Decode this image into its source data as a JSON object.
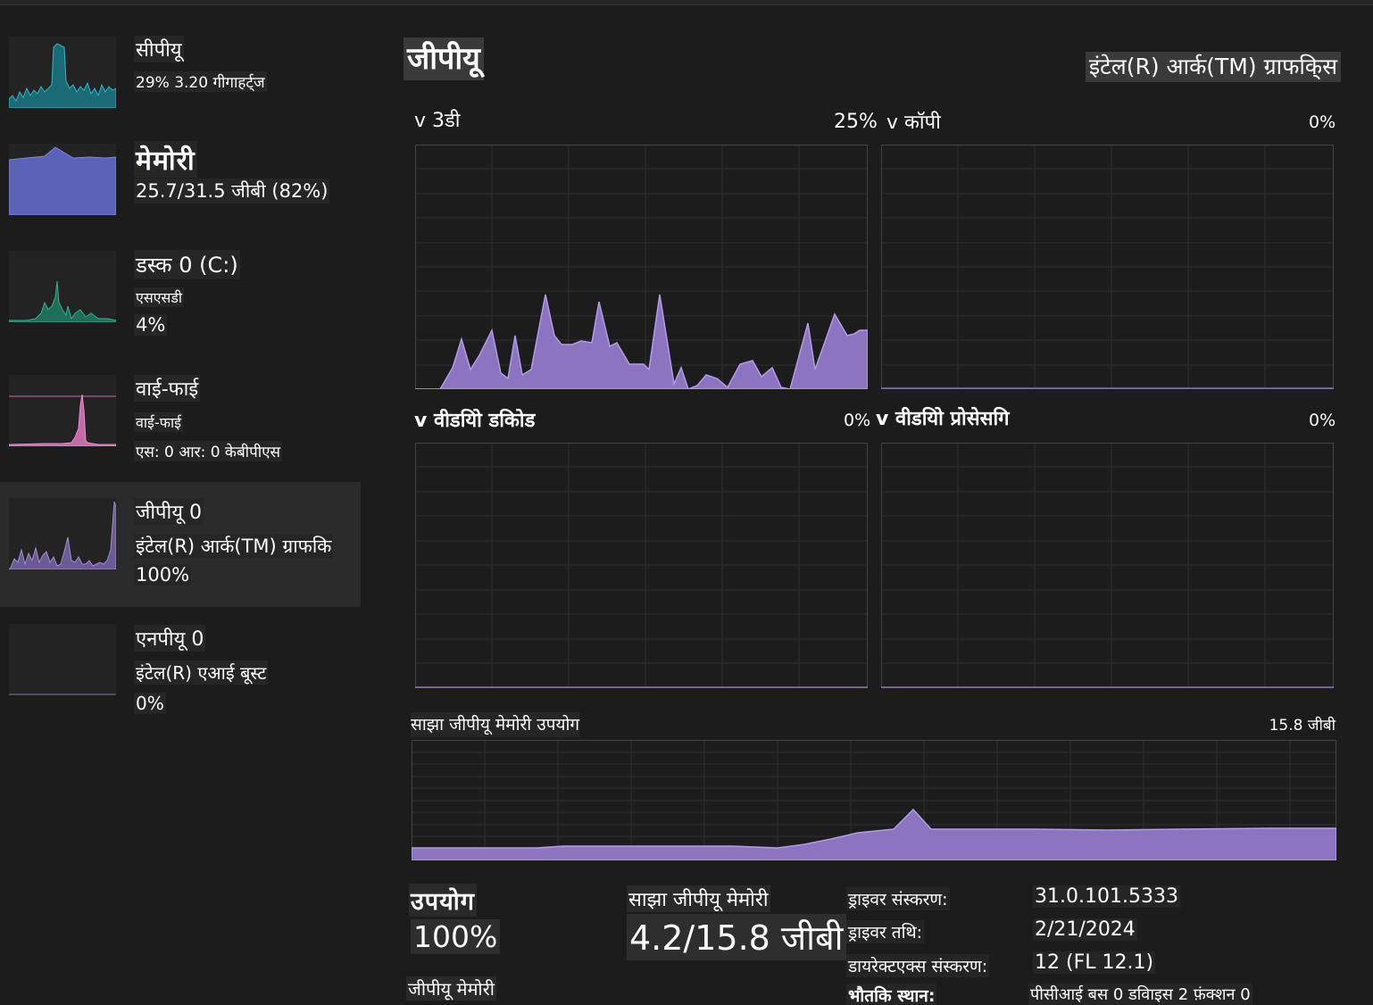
{
  "sidebar": {
    "cpu": {
      "title": "सीपीयू",
      "sub": "29% 3.20 गीगाहर्ट्ज"
    },
    "memory": {
      "title": "मेमोरी",
      "sub": "25.7/31.5 जीबी (82%)"
    },
    "disk": {
      "title": "डस्क 0 (C:)",
      "type": "एसएसडी",
      "pct": "4%"
    },
    "wifi": {
      "title": "वाई-फाई",
      "sub": "वाई-फाई",
      "rate": "एस: 0 आर: 0 केबीपीएस"
    },
    "gpu": {
      "title": "जीपीयू 0",
      "sub": "इंटेल(R) आर्क(TM) ग्राफकि",
      "pct": "100%"
    },
    "npu": {
      "title": "एनपीयू 0",
      "sub": "इंटेल(R) एआई बूस्ट",
      "pct": "0%"
    }
  },
  "main": {
    "title": "जीपीयू",
    "adapter": "इंटेल(R) आर्क(TM) ग्राफकि्स",
    "engines": [
      {
        "label": "v 3डी",
        "pct": "25%"
      },
      {
        "label": "v कॉपी",
        "pct": "0%"
      },
      {
        "label": "v वीडयिो डकिोड",
        "pct": "0%"
      },
      {
        "label": "v वीडयिो प्रोसेसगि",
        "pct": "0%"
      }
    ],
    "shared_memory": {
      "label": "साझा जीपीयू मेमोरी उपयोग",
      "max": "15.8 जीबी"
    }
  },
  "stats": {
    "usage_label": "उपयोग",
    "usage_value": "100%",
    "shared_label": "साझा जीपीयू मेमोरी",
    "shared_value": "4.2/15.8 जीबी",
    "gpu_memory_label": "जीपीयू मेमोरी"
  },
  "info": {
    "driver_version_label": "ड्राइवर संस्करण:",
    "driver_version": "31.0.101.5333",
    "driver_date_label": "ड्राइवर तथि:",
    "driver_date": "2/21/2024",
    "directx_label": "डायरेक्टएक्स संस्करण:",
    "directx": "12 (FL 12.1)",
    "location_label": "भौतकि स्थान:",
    "location": "पीसीआई बस 0 डवािइस 2 फ़ंक्शन 0"
  },
  "colors": {
    "cpu": "#1fa3b5",
    "memory": "#6b72c9",
    "disk": "#2a9b7a",
    "wifi": "#e07fc0",
    "gpu": "#9a7fc7"
  }
}
